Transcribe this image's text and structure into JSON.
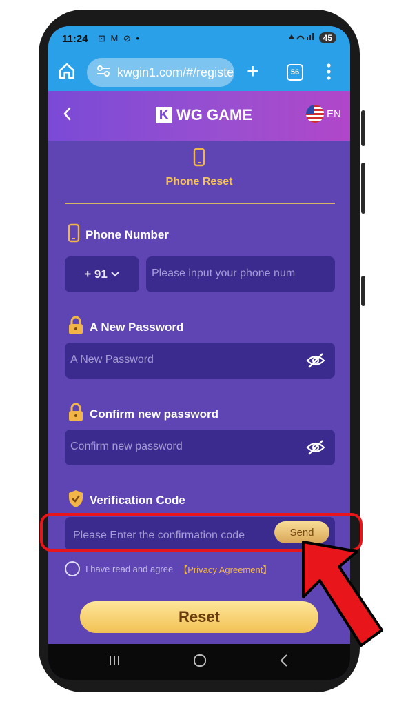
{
  "status_bar": {
    "time": "11:24",
    "icons": "⊡ M ⊘ •",
    "battery": "45"
  },
  "browser": {
    "url": "kwgin1.com/#/registe",
    "tab_count": "56"
  },
  "header": {
    "brand": "WG GAME",
    "brand_mark": "K",
    "language": "EN"
  },
  "tab": {
    "label": "Phone Reset"
  },
  "phone": {
    "label": "Phone Number",
    "country_code": "+ 91",
    "placeholder": "Please input your phone num"
  },
  "new_password": {
    "label": "A New Password",
    "placeholder": "A New Password"
  },
  "confirm_password": {
    "label": "Confirm new password",
    "placeholder": "Confirm new password"
  },
  "verification": {
    "label": "Verification Code",
    "placeholder": "Please Enter the confirmation code",
    "send_label": "Send"
  },
  "agreement": {
    "text": "I have read and agree",
    "link": "【Privacy Agreement】"
  },
  "reset_label": "Reset",
  "colors": {
    "accent_gold": "#f2c254",
    "panel_purple": "#5e45b3",
    "field_purple": "#3b2b8e",
    "browser_blue": "#29a0e8",
    "highlight_red": "#e8161a"
  }
}
